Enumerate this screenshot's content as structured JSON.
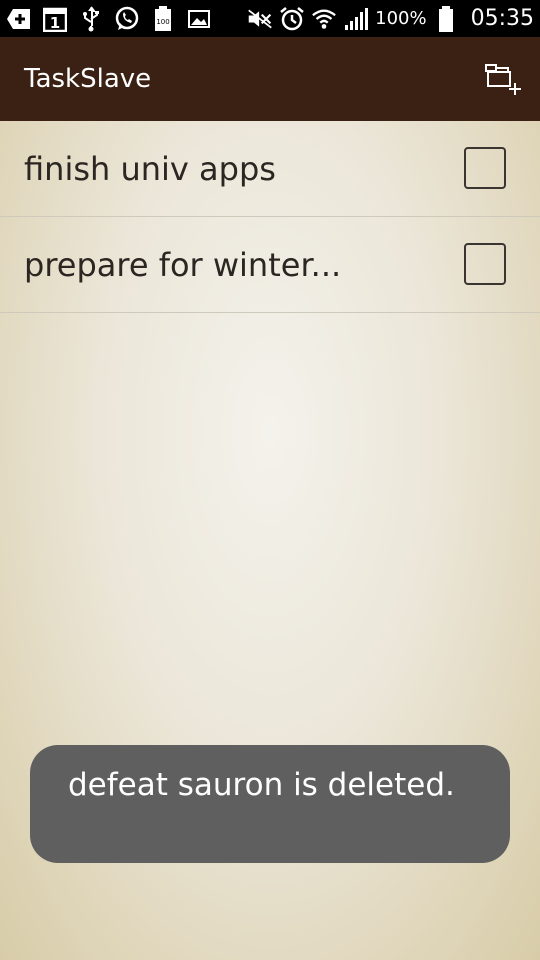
{
  "status_bar": {
    "battery_text": "100%",
    "clock": "05:35",
    "notification_count": "1",
    "battery_icon_text": "100"
  },
  "app_bar": {
    "title": "TaskSlave"
  },
  "tasks": [
    {
      "label": "finish univ apps",
      "checked": false
    },
    {
      "label": "prepare for winter...",
      "checked": false
    }
  ],
  "toast": {
    "message": "defeat sauron  is deleted."
  },
  "colors": {
    "app_bar": "#3a2114",
    "toast_bg": "#5f5f5f",
    "status_bar": "#000000"
  }
}
